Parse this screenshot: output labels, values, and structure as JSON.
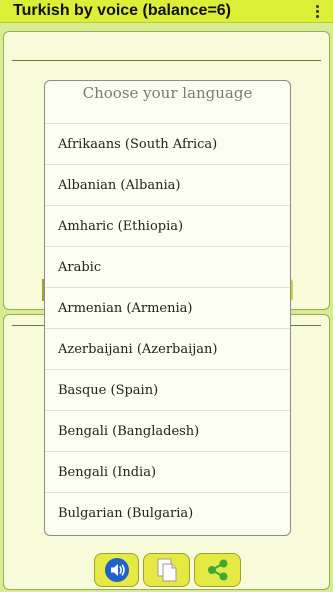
{
  "app_bar": {
    "title": "Turkish by voice (balance=6)",
    "menu_icon": "more-vert-icon"
  },
  "dialog": {
    "title": "Choose your language",
    "languages": [
      "Afrikaans (South Africa)",
      "Albanian (Albania)",
      "Amharic (Ethiopia)",
      "Arabic",
      "Armenian (Armenia)",
      "Azerbaijani (Azerbaijan)",
      "Basque (Spain)",
      "Bengali (Bangladesh)",
      "Bengali (India)",
      "Bulgarian (Bulgaria)"
    ]
  },
  "toolbar": {
    "speak_icon": "speaker-icon",
    "copy_icon": "copy-icon",
    "share_icon": "share-icon"
  },
  "colors": {
    "app_bar": "#dcef36",
    "background": "#d8ec92",
    "panel": "#f7fbd9",
    "button": "#e6e943",
    "speaker_blue": "#1e63c8",
    "share_green": "#3aaa35"
  }
}
